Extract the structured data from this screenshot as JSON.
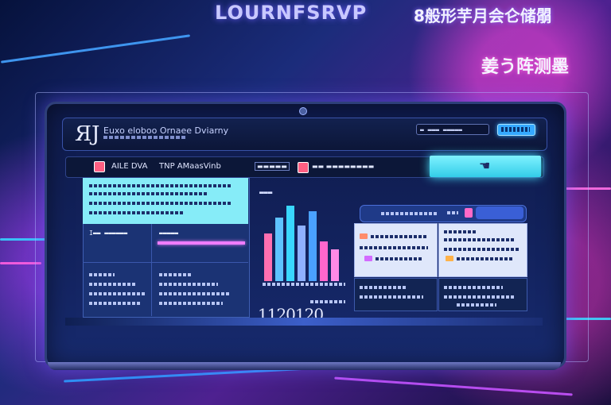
{
  "header": {
    "watermark_title": "LOURNFSRVP",
    "cjk_title": "8般形芋月会仑储朤",
    "cjk_subtitle": "姜う阵测墨"
  },
  "app": {
    "logo_mark": "ЯJ",
    "logo_text": "Euxo eloboo Ornaee Dviarny"
  },
  "toolbar": {
    "search_value": "▬ ▬▬▬ ▬▬▬▬▬"
  },
  "nav": {
    "tab1_label": "AILE DVA",
    "tab2_label": "TNP AMaasVinb",
    "tab3_label": "▬▬▬▬▬",
    "tab4_label": "▬▬ ▬▬▬▬▬▬▬▬"
  },
  "left_panel": {
    "cell1_label": "I▬▬ ▬▬▬▬▬▬",
    "cell2_label": "▬▬▬▬▬"
  },
  "chart_panel": {
    "header": "▬▬▬",
    "big_number": "1120120"
  },
  "colors": {
    "accent_cyan": "#86ecf8",
    "accent_pink": "#ff5f82",
    "accent_blue": "#35a9ff"
  },
  "icons": {
    "hand": "hand-icon"
  }
}
